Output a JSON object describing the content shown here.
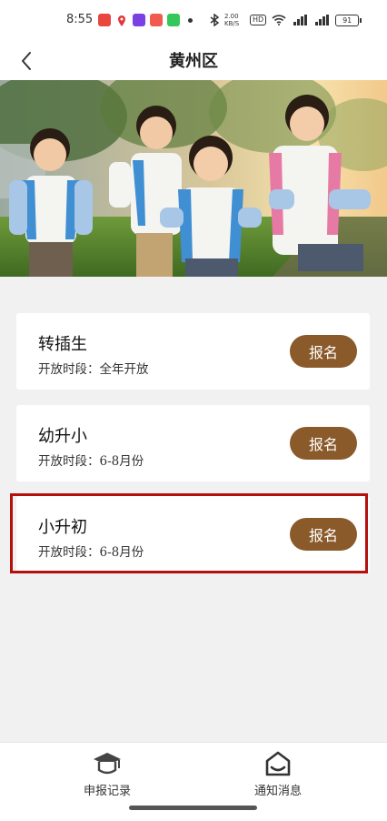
{
  "status_bar": {
    "time": "8:55",
    "network_speed": "2.00 KB/S",
    "hd": "HD",
    "battery": "91"
  },
  "header": {
    "title": "黄州区"
  },
  "cards": [
    {
      "title": "转插生",
      "period": "开放时段：全年开放",
      "button": "报名"
    },
    {
      "title": "幼升小",
      "period": "开放时段：6-8月份",
      "button": "报名"
    },
    {
      "title": "小升初",
      "period": "开放时段：6-8月份",
      "button": "报名"
    }
  ],
  "tabbar": {
    "tabs": [
      {
        "label": "申报记录",
        "icon": "graduation-cap-icon"
      },
      {
        "label": "通知消息",
        "icon": "home-inbox-icon"
      }
    ]
  },
  "colors": {
    "accent": "#8a5a2a",
    "highlight": "#b3100e",
    "background": "#f1f1f1"
  }
}
